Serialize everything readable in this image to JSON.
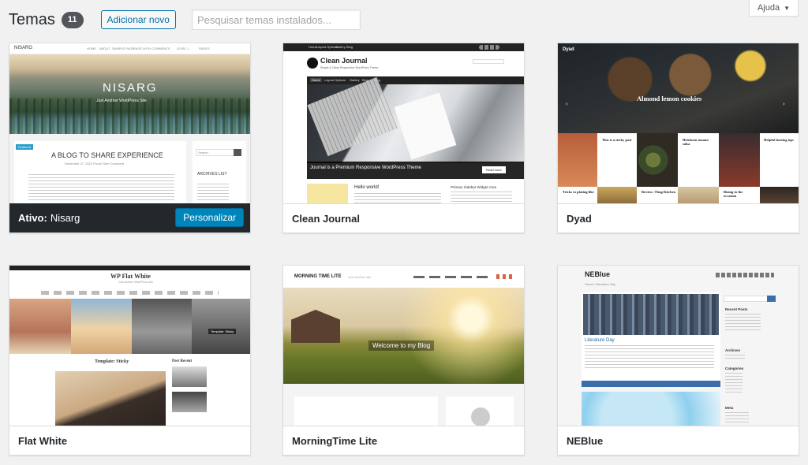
{
  "header": {
    "title": "Temas",
    "count": "11",
    "add_new": "Adicionar novo",
    "search_placeholder": "Pesquisar temas instalados..."
  },
  "help": {
    "label": "Ajuda"
  },
  "themes": [
    {
      "name": "Nisarg",
      "active": true,
      "active_label": "Ativo:",
      "customize_label": "Personalizar",
      "preview": {
        "logo": "NISARG",
        "nav": [
          "HOME",
          "ABOUT",
          "SAMPLE PAGE",
          "PAGE WITH COMMENTS",
          "LEVEL 1",
          "PAGES"
        ],
        "hero_title": "NISARG",
        "hero_tagline": "Just Another WordPress Site",
        "post_tag": "Featured",
        "post_title": "A BLOG TO SHARE EXPERIENCE",
        "post_meta": "December 27, 2021   Ficou! Sem Comment",
        "sidebar_search": "Search",
        "archives": "ARCHIVES LIST"
      }
    },
    {
      "name": "Clean Journal",
      "active": false,
      "preview": {
        "topnav": [
          "Home",
          "Layout Options",
          "Gallery",
          "Blog",
          "Blog"
        ],
        "logo": "Clean Journal",
        "tagline": "Simple & Clean Responsive WordPress Theme",
        "nav": [
          "Home",
          "Layout Options",
          "Gallery",
          "Blog",
          "Blog"
        ],
        "slide_title": "Journal is a Premium Responsive WordPress Theme",
        "more": "Read more",
        "post_title": "Hello world!",
        "sidebar_title": "Primary Sidebar Widget Area"
      }
    },
    {
      "name": "Dyad",
      "active": false,
      "preview": {
        "logo": "Dyad",
        "hero_title": "Almond lemon cookies",
        "tiles": [
          "This is a sticky post",
          "Heirloom tomato salsa",
          "Helpful hosting tips",
          "Tricks to plating like",
          "Review: Thug Kitchen",
          "Rising to the occasion"
        ]
      }
    },
    {
      "name": "Flat White",
      "active": false,
      "preview": {
        "logo": "WP Flat White",
        "tagline": "Just another WordPress site",
        "post_title": "Template: Sticky",
        "side_title": "Post Recent",
        "overlay": "Template: Sticky"
      }
    },
    {
      "name": "MorningTime Lite",
      "active": false,
      "preview": {
        "logo": "MORNING TIME LITE",
        "tagline": "Just another site",
        "hero_title": "Welcome to my Blog"
      }
    },
    {
      "name": "NEBlue",
      "active": false,
      "preview": {
        "logo": "NEBlue",
        "breadcrumb": "Home  /  Literature Day",
        "post_title": "Literature Day",
        "sidebar": [
          "Recent Posts",
          "Archives",
          "Categories",
          "Meta"
        ],
        "search_btn": "Search"
      }
    }
  ]
}
